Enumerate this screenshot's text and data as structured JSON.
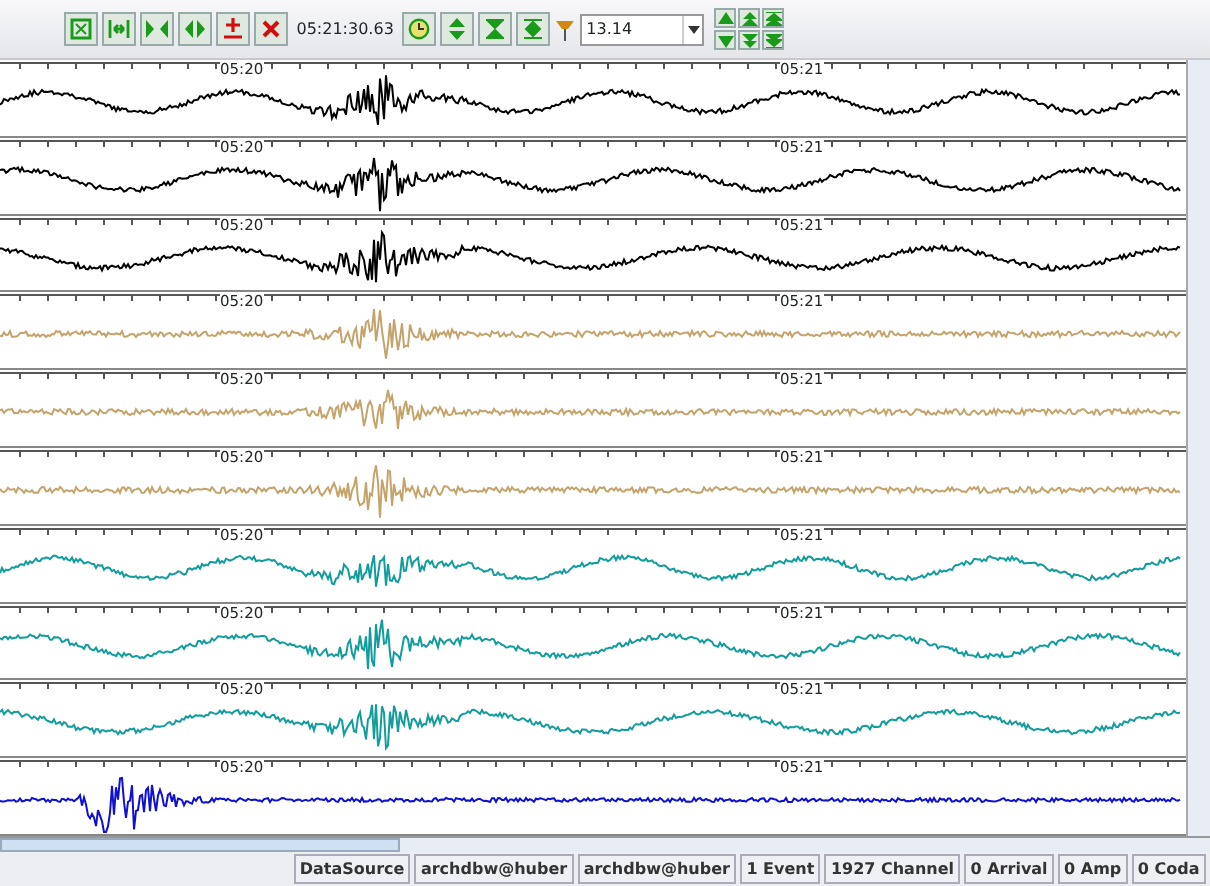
{
  "toolbar": {
    "time": "05:21:30.63",
    "zoom_value": "13.14"
  },
  "traces": [
    {
      "color": "#000000",
      "kind": "wave",
      "ticks": [
        "05:20",
        "05:21"
      ]
    },
    {
      "color": "#000000",
      "kind": "wave",
      "ticks": [
        "05:20",
        "05:21"
      ]
    },
    {
      "color": "#000000",
      "kind": "wave",
      "ticks": [
        "05:20",
        "05:21"
      ]
    },
    {
      "color": "#c4a46c",
      "kind": "noise",
      "ticks": [
        "05:20",
        "05:21"
      ]
    },
    {
      "color": "#c4a46c",
      "kind": "noise",
      "ticks": [
        "05:20",
        "05:21"
      ]
    },
    {
      "color": "#c4a46c",
      "kind": "noise",
      "ticks": [
        "05:20",
        "05:21"
      ]
    },
    {
      "color": "#139c9c",
      "kind": "wave",
      "ticks": [
        "05:20",
        "05:21"
      ]
    },
    {
      "color": "#139c9c",
      "kind": "wave",
      "ticks": [
        "05:20",
        "05:21"
      ]
    },
    {
      "color": "#139c9c",
      "kind": "wave",
      "ticks": [
        "05:20",
        "05:21"
      ]
    },
    {
      "color": "#1010d0",
      "kind": "early",
      "ticks": [
        "05:20",
        "05:21"
      ]
    }
  ],
  "status_bar": [
    "DataSource",
    "archdbw@huber",
    "archdbw@huber",
    "1 Event",
    "1927 Channel",
    "0 Arrival",
    "0 Amp",
    "0 Coda"
  ]
}
